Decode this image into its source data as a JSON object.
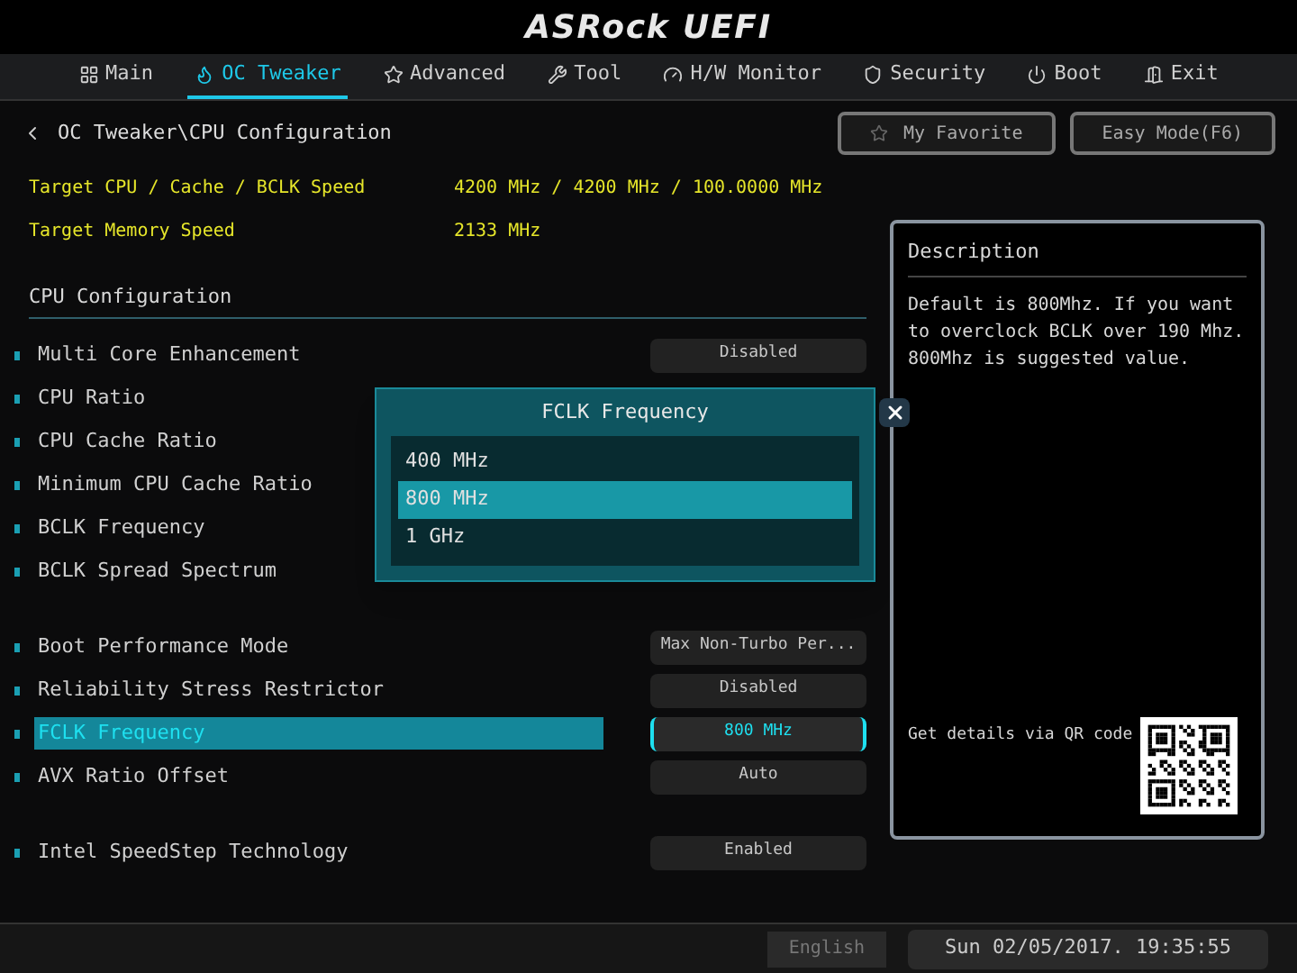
{
  "header": {
    "logo": "ASRock UEFI"
  },
  "tabs": [
    {
      "label": "Main",
      "selected": false
    },
    {
      "label": "OC Tweaker",
      "selected": true
    },
    {
      "label": "Advanced",
      "selected": false
    },
    {
      "label": "Tool",
      "selected": false
    },
    {
      "label": "H/W Monitor",
      "selected": false
    },
    {
      "label": "Security",
      "selected": false
    },
    {
      "label": "Boot",
      "selected": false
    },
    {
      "label": "Exit",
      "selected": false
    }
  ],
  "breadcrumb": "OC Tweaker\\CPU Configuration",
  "toolbar_buttons": [
    {
      "label": "My Favorite"
    },
    {
      "label": "Easy Mode(F6)"
    }
  ],
  "info": [
    {
      "label": "Target CPU / Cache / BCLK Speed",
      "value": "4200 MHz / 4200 MHz / 100.0000 MHz"
    },
    {
      "label": "Target Memory Speed",
      "value": "2133 MHz"
    }
  ],
  "section_title": "CPU Configuration",
  "setting_groups": [
    [
      {
        "label": "Multi Core Enhancement",
        "value": "Disabled",
        "selected": false
      },
      {
        "label": "CPU Ratio",
        "selected": false
      },
      {
        "label": "CPU Cache Ratio",
        "selected": false
      },
      {
        "label": "Minimum CPU Cache Ratio",
        "selected": false
      },
      {
        "label": "BCLK Frequency",
        "selected": false
      },
      {
        "label": "BCLK Spread Spectrum",
        "selected": false
      }
    ],
    [
      {
        "label": "Boot Performance Mode",
        "value": "Max Non-Turbo Per...",
        "selected": false
      },
      {
        "label": "Reliability Stress Restrictor",
        "value": "Disabled",
        "selected": false
      },
      {
        "label": "FCLK Frequency",
        "value": "800 MHz",
        "selected": true
      },
      {
        "label": "AVX Ratio Offset",
        "value": "Auto",
        "selected": false
      }
    ],
    [
      {
        "label": "Intel SpeedStep Technology",
        "value": "Enabled",
        "selected": false
      }
    ]
  ],
  "description": {
    "title": "Description",
    "text": "Default is 800Mhz. If you want to overclock BCLK over 190 Mhz. 800Mhz is suggested value.",
    "qr_label": "Get details via QR code"
  },
  "dialog": {
    "title": "FCLK Frequency",
    "options": [
      {
        "label": "400 MHz",
        "selected": false
      },
      {
        "label": "800 MHz",
        "selected": true
      },
      {
        "label": "1 GHz",
        "selected": false
      }
    ]
  },
  "status_bar": {
    "language": "English",
    "datetime": "Sun 02/05/2017. 19:35:55"
  }
}
